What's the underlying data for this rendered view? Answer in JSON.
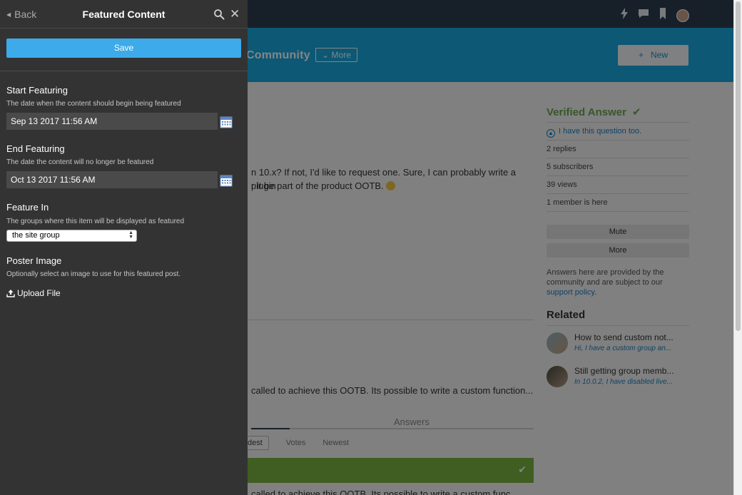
{
  "panel": {
    "back_label": "Back",
    "title": "Featured Content",
    "save_label": "Save",
    "start": {
      "label": "Start Featuring",
      "description": "The date when the content should begin being featured",
      "value": "Sep 13 2017 11:56 AM"
    },
    "end": {
      "label": "End Featuring",
      "description": "The date the content will no longer be featured",
      "value": "Oct 13 2017 11:56 AM"
    },
    "feature_in": {
      "label": "Feature In",
      "description": "The groups where this item will be displayed as featured",
      "selected": "the site group"
    },
    "poster": {
      "label": "Poster Image",
      "description": "Optionally select an image to use for this featured post.",
      "upload_label": "Upload File"
    }
  },
  "banner": {
    "title": "Community",
    "more_label": "More",
    "new_label": "New"
  },
  "question": {
    "line1": "n 10.x? If not, I'd like to request one. Sure, I can probably write a plugin",
    "line2": "r it be part of the product OOTB.",
    "answer_excerpt": "called to achieve this OOTB. Its possible to write a custom function...",
    "answer_line": "called to achieve this OOTB.  Its possible to write a custom func"
  },
  "tabs": {
    "answers_label": "Answers",
    "sort_oldest": "dest",
    "sort_votes": "Votes",
    "sort_newest": "Newest"
  },
  "sidebar": {
    "verified_label": "Verified Answer",
    "have_question": "I have this question too.",
    "replies": "2 replies",
    "subscribers": "5 subscribers",
    "views": "39 views",
    "members_here": "1 member is here",
    "mute_label": "Mute",
    "more_label": "More",
    "note_text": "Answers here are provided by the community and are subject to our",
    "note_link": "support policy",
    "note_end": ".",
    "related_title": "Related",
    "related": [
      {
        "title": "How to send custom not...",
        "snippet": "Hi, I have a custom group an..."
      },
      {
        "title": "Still getting group memb...",
        "snippet": "In 10.0.2, I have disabled live..."
      }
    ]
  },
  "colors": {
    "panel_bg": "#333333",
    "save_button": "#3daae9",
    "banner": "#17a9e1",
    "verified_green": "#6aa84f"
  }
}
